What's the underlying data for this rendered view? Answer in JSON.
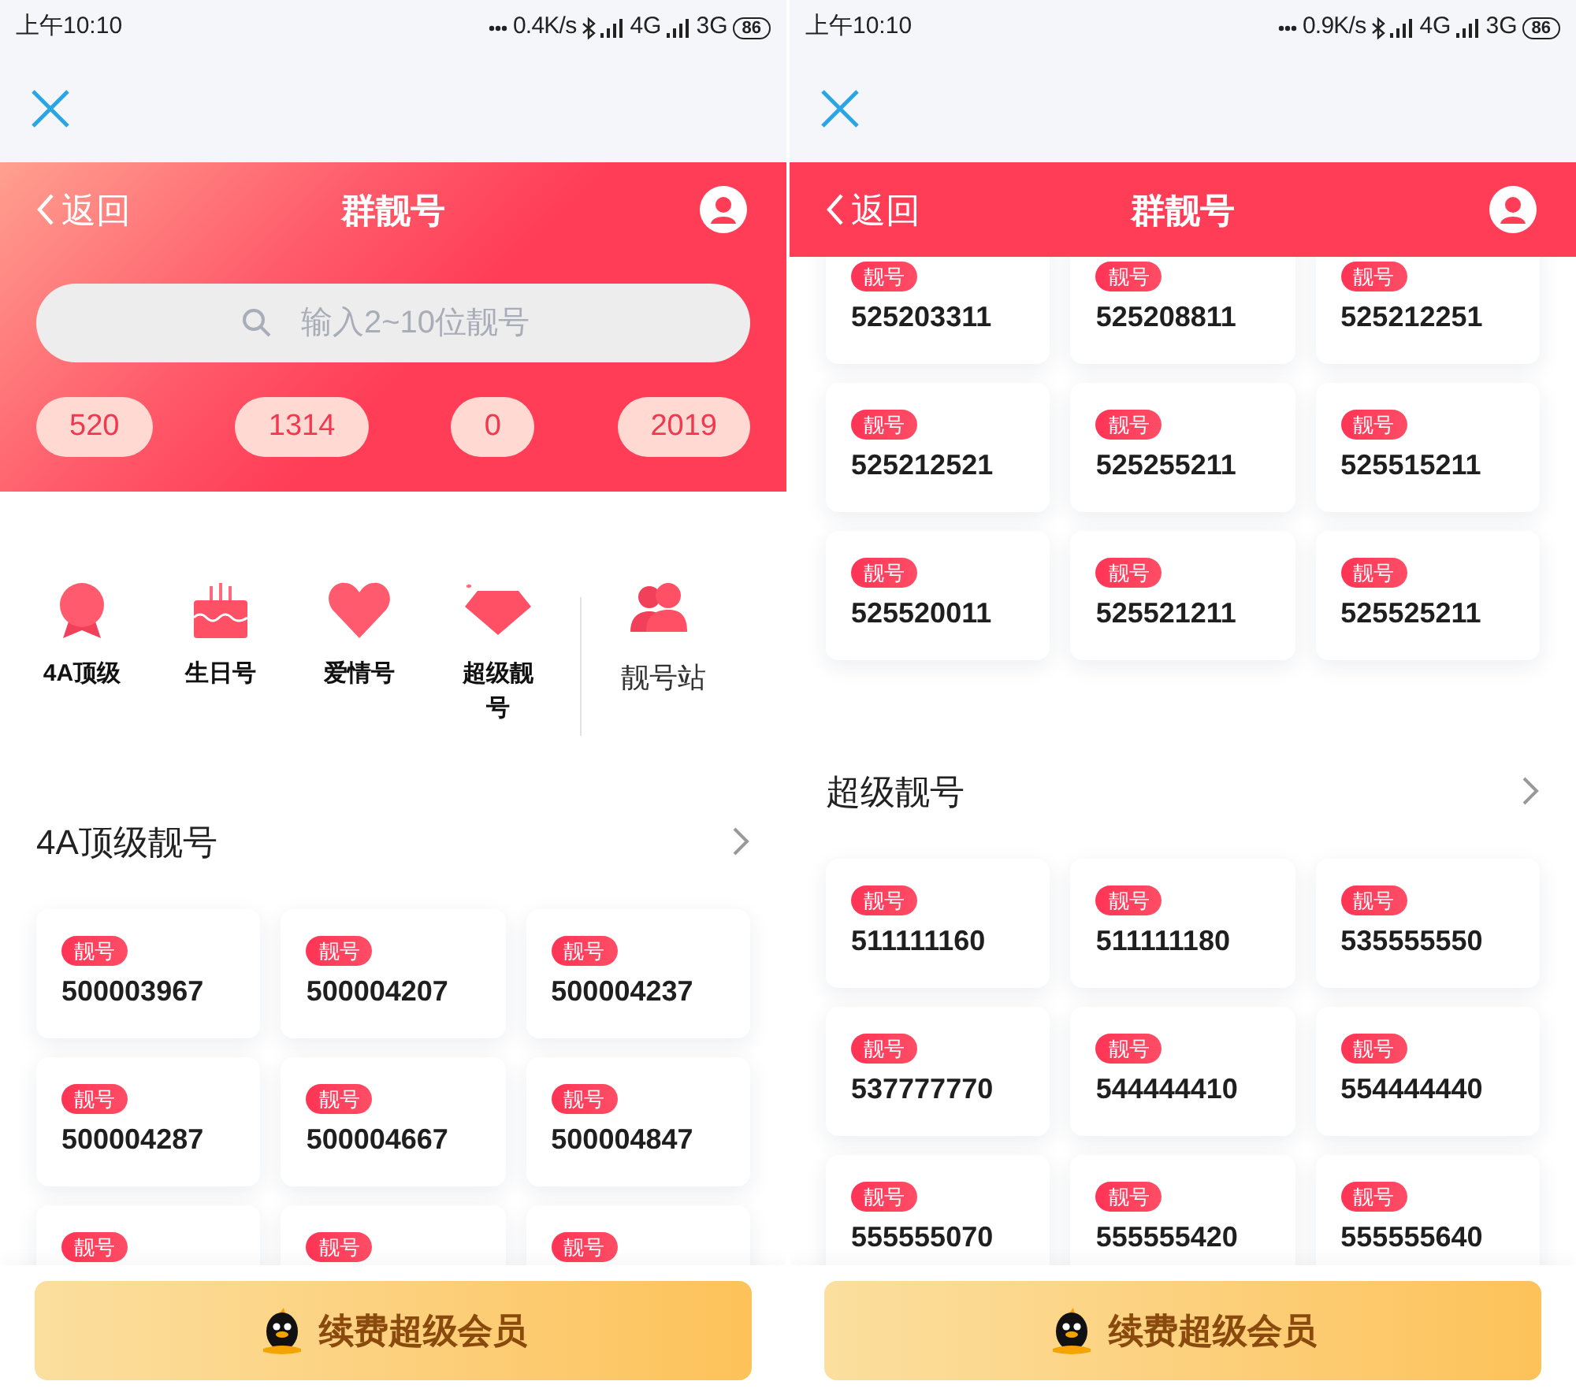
{
  "screens": [
    {
      "status_bar": {
        "time": "上午10:10",
        "speed": "0.4K/s",
        "network_1": "4G",
        "network_2": "3G",
        "battery": "86"
      },
      "header": {
        "back": "返回",
        "title": "群靓号"
      },
      "search": {
        "placeholder": "输入2~10位靓号"
      },
      "quick_tags": [
        "520",
        "1314",
        "0",
        "2019"
      ],
      "categories": [
        {
          "kind": "medal",
          "label": "4A顶级"
        },
        {
          "kind": "cake",
          "label": "生日号"
        },
        {
          "kind": "heart",
          "label": "爱情号"
        },
        {
          "kind": "diamond",
          "label": "超级靓号"
        },
        {
          "kind": "people",
          "label": "靓号站"
        }
      ],
      "sections": [
        {
          "title": "4A顶级靓号",
          "items": [
            {
              "badge": "靓号",
              "number": "500003967"
            },
            {
              "badge": "靓号",
              "number": "500004207"
            },
            {
              "badge": "靓号",
              "number": "500004237"
            },
            {
              "badge": "靓号",
              "number": "500004287"
            },
            {
              "badge": "靓号",
              "number": "500004667"
            },
            {
              "badge": "靓号",
              "number": "500004847"
            },
            {
              "badge": "靓号"
            },
            {
              "badge": "靓号"
            },
            {
              "badge": "靓号"
            }
          ]
        }
      ],
      "footer_button": "续费超级会员"
    },
    {
      "status_bar": {
        "time": "上午10:10",
        "speed": "0.9K/s",
        "network_1": "4G",
        "network_2": "3G",
        "battery": "86"
      },
      "header": {
        "back": "返回",
        "title": "群靓号"
      },
      "sections": [
        {
          "items": [
            {
              "badge": "靓号",
              "number": "525203311"
            },
            {
              "badge": "靓号",
              "number": "525208811"
            },
            {
              "badge": "靓号",
              "number": "525212251"
            },
            {
              "badge": "靓号",
              "number": "525212521"
            },
            {
              "badge": "靓号",
              "number": "525255211"
            },
            {
              "badge": "靓号",
              "number": "525515211"
            },
            {
              "badge": "靓号",
              "number": "525520011"
            },
            {
              "badge": "靓号",
              "number": "525521211"
            },
            {
              "badge": "靓号",
              "number": "525525211"
            }
          ]
        },
        {
          "title": "超级靓号",
          "items": [
            {
              "badge": "靓号",
              "number": "511111160"
            },
            {
              "badge": "靓号",
              "number": "511111180"
            },
            {
              "badge": "靓号",
              "number": "535555550"
            },
            {
              "badge": "靓号",
              "number": "537777770"
            },
            {
              "badge": "靓号",
              "number": "544444410"
            },
            {
              "badge": "靓号",
              "number": "554444440"
            },
            {
              "badge": "靓号",
              "number": "555555070"
            },
            {
              "badge": "靓号",
              "number": "555555420"
            },
            {
              "badge": "靓号",
              "number": "555555640"
            }
          ]
        }
      ],
      "footer_button": "续费超级会员"
    }
  ]
}
